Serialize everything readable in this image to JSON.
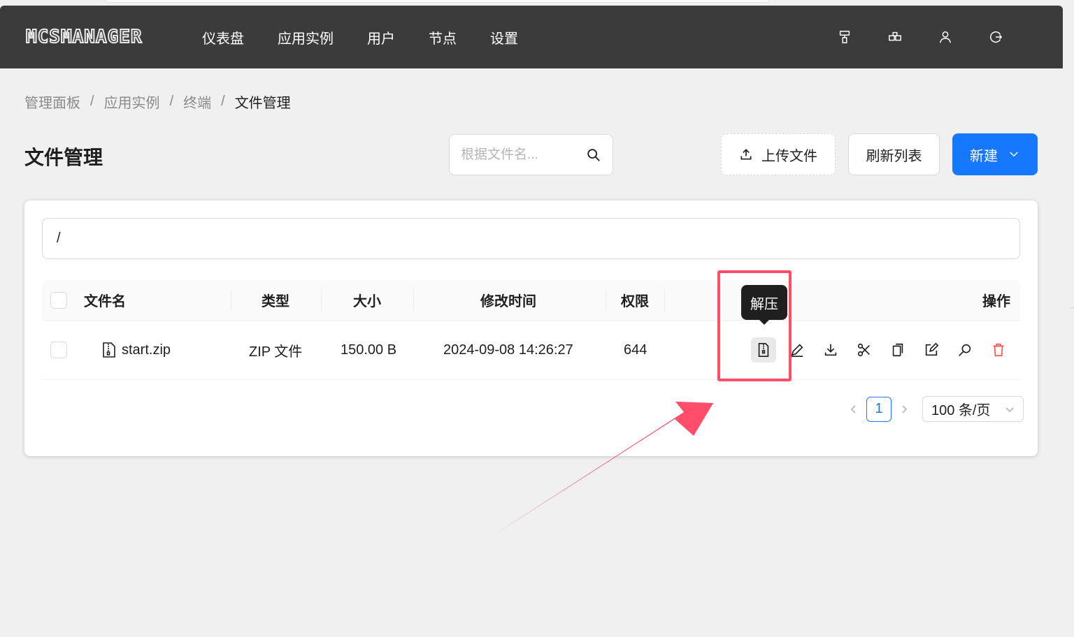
{
  "nav": {
    "logo": "MCSMANAGER",
    "items": [
      "仪表盘",
      "应用实例",
      "用户",
      "节点",
      "设置"
    ],
    "icons": [
      "brush-icon",
      "nodes-icon",
      "user-icon",
      "logout-icon"
    ]
  },
  "breadcrumb": [
    "管理面板",
    "应用实例",
    "终端",
    "文件管理"
  ],
  "page": {
    "title": "文件管理"
  },
  "search": {
    "placeholder": "根据文件名..."
  },
  "buttons": {
    "upload": "上传文件",
    "refresh": "刷新列表",
    "new": "新建"
  },
  "path": "/",
  "table": {
    "headers": {
      "name": "文件名",
      "type": "类型",
      "size": "大小",
      "modified": "修改时间",
      "perm": "权限",
      "actions": "操作"
    },
    "rows": [
      {
        "name": "start.zip",
        "type": "ZIP 文件",
        "size": "150.00 B",
        "modified": "2024-09-08 14:26:27",
        "perm": "644"
      }
    ]
  },
  "tooltip": "解压",
  "pagination": {
    "current": "1",
    "page_size": "100 条/页"
  },
  "colors": {
    "primary": "#1677ff",
    "danger": "#ff4d4f",
    "highlight": "#ff4d6a",
    "navbar": "#3b3b3b"
  }
}
